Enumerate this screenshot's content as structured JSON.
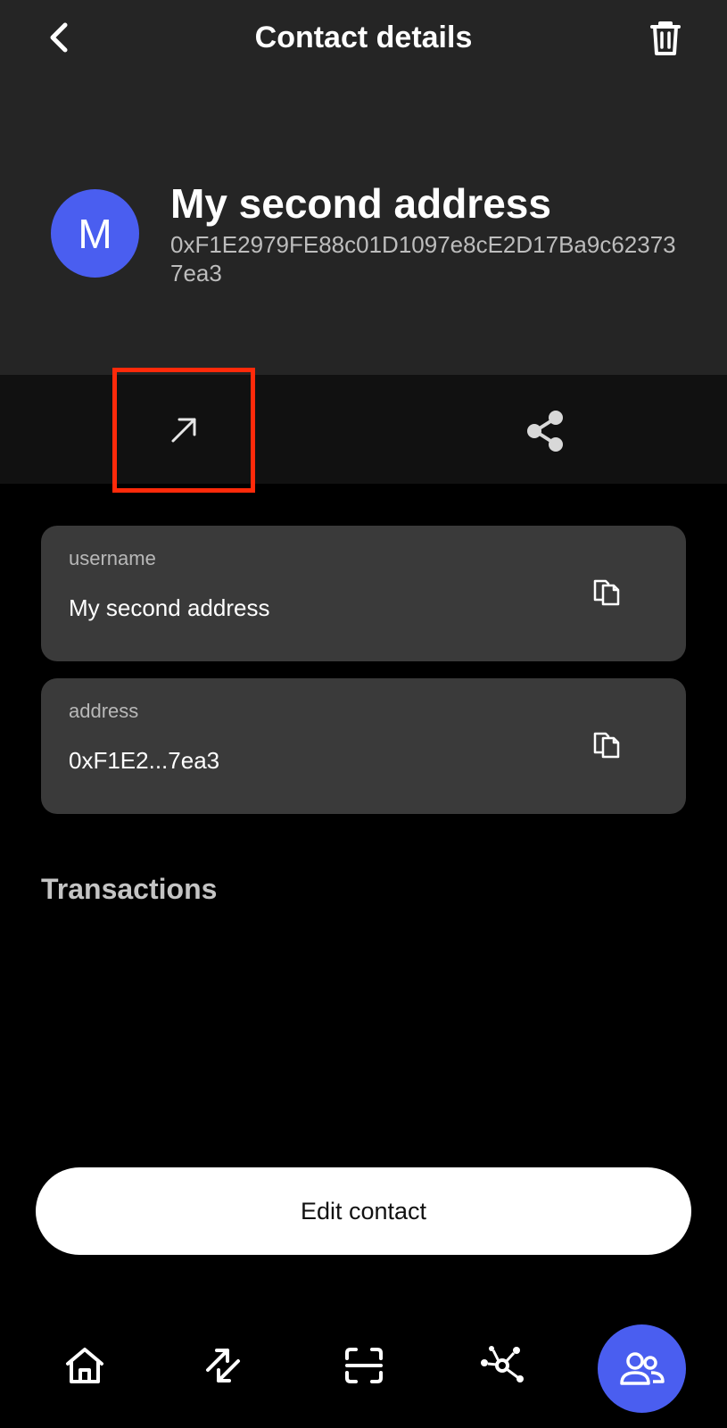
{
  "header": {
    "title": "Contact details",
    "back_icon": "chevron-left-icon",
    "delete_icon": "trash-icon"
  },
  "contact": {
    "initial": "M",
    "name": "My second address",
    "address": "0xF1E2979FE88c01D1097e8cE2D17Ba9c623737ea3",
    "avatar_color": "#4a5ef0"
  },
  "actions": {
    "send_icon": "arrow-up-right-icon",
    "share_icon": "share-icon"
  },
  "fields": [
    {
      "label": "username",
      "value": "My second address",
      "copy_icon": "copy-icon"
    },
    {
      "label": "address",
      "value": "0xF1E2...7ea3",
      "copy_icon": "copy-icon"
    }
  ],
  "transactions": {
    "title": "Transactions"
  },
  "edit_button": {
    "label": "Edit contact"
  },
  "nav": {
    "items": [
      {
        "icon": "home-icon",
        "active": false
      },
      {
        "icon": "swap-icon",
        "active": false
      },
      {
        "icon": "scan-icon",
        "active": false
      },
      {
        "icon": "network-icon",
        "active": false
      },
      {
        "icon": "contacts-icon",
        "active": true
      }
    ]
  },
  "colors": {
    "accent": "#4a5ef0",
    "highlight": "#ff2a0a"
  }
}
